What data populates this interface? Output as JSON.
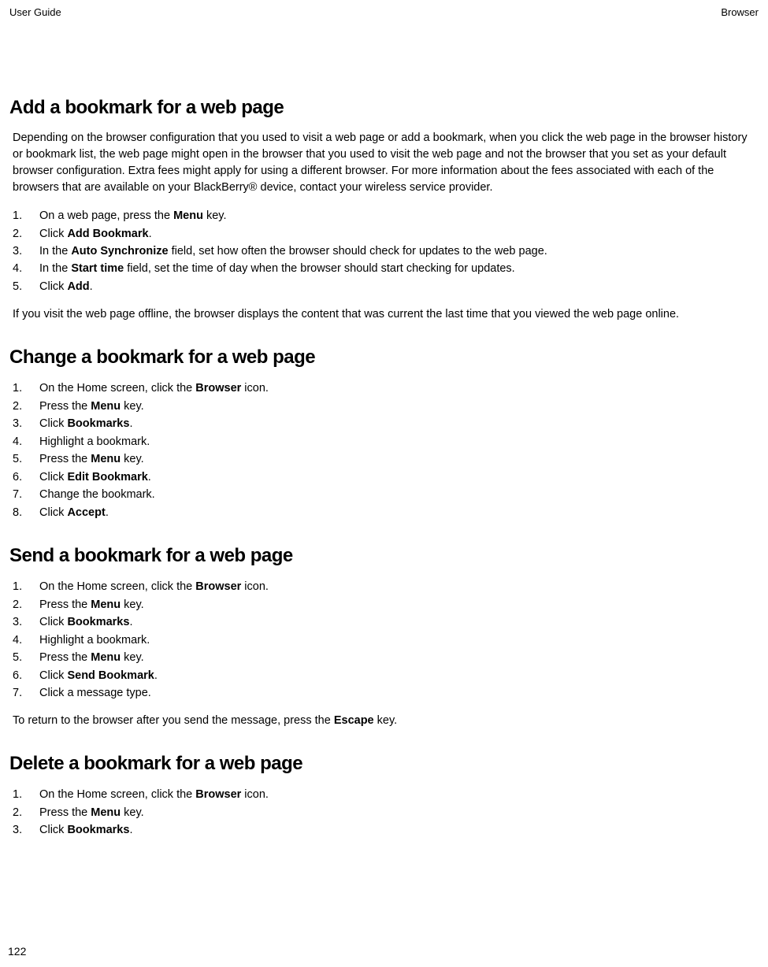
{
  "header": {
    "left": "User Guide",
    "right": "Browser"
  },
  "sections": {
    "add": {
      "title": "Add a bookmark for a web page",
      "intro": "Depending on the browser configuration that you used to visit a web page or add a bookmark, when you click the web page in the browser history or bookmark list, the web page might open in the browser that you used to visit the web page and not the browser that you set as your default browser configuration. Extra fees might apply for using a different browser. For more information about the fees associated with each of the browsers that are available on your BlackBerry® device, contact your wireless service provider.",
      "steps": {
        "s1_pre": "On a web page, press the ",
        "s1_bold": "Menu",
        "s1_post": " key.",
        "s2_pre": "Click ",
        "s2_bold": "Add Bookmark",
        "s2_post": ".",
        "s3_pre": "In the ",
        "s3_bold": "Auto Synchronize",
        "s3_post": " field, set how often the browser should check for updates to the web page.",
        "s4_pre": "In the ",
        "s4_bold": "Start time",
        "s4_post": " field, set the time of day when the browser should start checking for updates.",
        "s5_pre": "Click ",
        "s5_bold": "Add",
        "s5_post": "."
      },
      "after": "If you visit the web page offline, the browser displays the content that was current the last time that you viewed the web page online."
    },
    "change": {
      "title": "Change a bookmark for a web page",
      "steps": {
        "s1_pre": "On the Home screen, click the ",
        "s1_bold": "Browser",
        "s1_post": " icon.",
        "s2_pre": "Press the ",
        "s2_bold": "Menu",
        "s2_post": " key.",
        "s3_pre": "Click ",
        "s3_bold": "Bookmarks",
        "s3_post": ".",
        "s4": "Highlight a bookmark.",
        "s5_pre": "Press the ",
        "s5_bold": "Menu",
        "s5_post": " key.",
        "s6_pre": "Click ",
        "s6_bold": "Edit Bookmark",
        "s6_post": ".",
        "s7": "Change the bookmark.",
        "s8_pre": "Click ",
        "s8_bold": "Accept",
        "s8_post": "."
      }
    },
    "send": {
      "title": "Send a bookmark for a web page",
      "steps": {
        "s1_pre": "On the Home screen, click the ",
        "s1_bold": "Browser",
        "s1_post": " icon.",
        "s2_pre": "Press the ",
        "s2_bold": "Menu",
        "s2_post": " key.",
        "s3_pre": "Click ",
        "s3_bold": "Bookmarks",
        "s3_post": ".",
        "s4": "Highlight a bookmark.",
        "s5_pre": "Press the ",
        "s5_bold": "Menu",
        "s5_post": " key.",
        "s6_pre": "Click ",
        "s6_bold": "Send Bookmark",
        "s6_post": ".",
        "s7": "Click a message type."
      },
      "after_pre": "To return to the browser after you send the message, press the ",
      "after_bold": "Escape",
      "after_post": " key."
    },
    "delete": {
      "title": "Delete a bookmark for a web page",
      "steps": {
        "s1_pre": "On the Home screen, click the ",
        "s1_bold": "Browser",
        "s1_post": " icon.",
        "s2_pre": "Press the ",
        "s2_bold": "Menu",
        "s2_post": " key.",
        "s3_pre": "Click ",
        "s3_bold": "Bookmarks",
        "s3_post": "."
      }
    }
  },
  "page_number": "122"
}
